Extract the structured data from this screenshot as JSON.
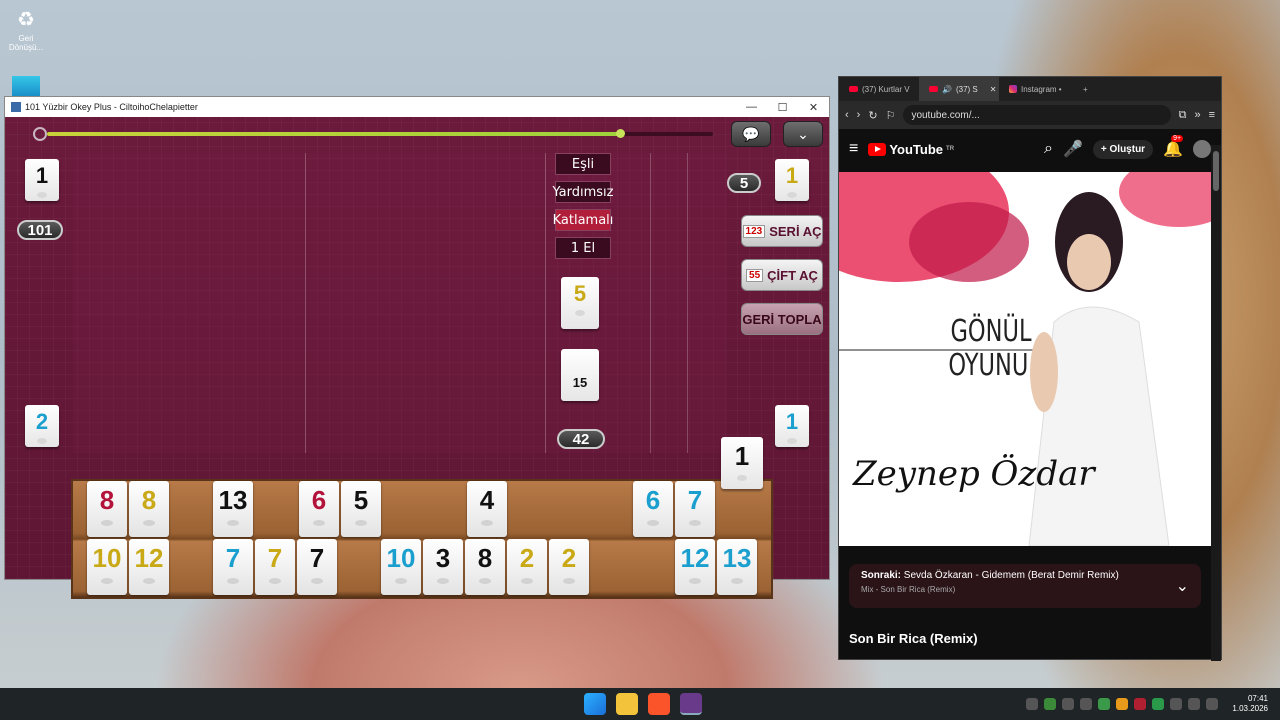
{
  "desktop": {
    "recycle_label_1": "Geri",
    "recycle_label_2": "Dönüşü..."
  },
  "game": {
    "window_title": "101 Yüzbir Okey Plus - CiltoihoChelapietter",
    "timer_progress": 0.86,
    "score_total": "101",
    "opponent_left_top": "1",
    "opponent_left_bottom": "2",
    "opponent_right_top": "1",
    "opponent_right_bottom": "1",
    "right_count": "5",
    "modes": [
      "Eşli",
      "Yardımsız",
      "Katlamalı",
      "1 El"
    ],
    "active_mode": "Katlamalı",
    "indicator_tile": "5",
    "deck_tile": "15",
    "remaining": "42",
    "drawn_tile": "1",
    "buttons": {
      "seri_ac": "SERİ AÇ",
      "cift_ac": "ÇİFT AÇ",
      "geri_topla": "GERİ TOPLA"
    },
    "rack_top": [
      {
        "v": "8",
        "c": "red"
      },
      {
        "v": "8",
        "c": "yellow"
      },
      {
        "v": "13",
        "c": "black"
      },
      {
        "v": "6",
        "c": "red"
      },
      {
        "v": "5",
        "c": "black"
      },
      {
        "v": "4",
        "c": "black"
      },
      {
        "v": "6",
        "c": "blue"
      },
      {
        "v": "7",
        "c": "blue"
      }
    ],
    "rack_bottom": [
      {
        "v": "10",
        "c": "yellow"
      },
      {
        "v": "12",
        "c": "yellow"
      },
      {
        "v": "7",
        "c": "blue"
      },
      {
        "v": "7",
        "c": "yellow"
      },
      {
        "v": "7",
        "c": "black"
      },
      {
        "v": "10",
        "c": "blue"
      },
      {
        "v": "3",
        "c": "black"
      },
      {
        "v": "8",
        "c": "black"
      },
      {
        "v": "2",
        "c": "yellow"
      },
      {
        "v": "2",
        "c": "yellow"
      },
      {
        "v": "12",
        "c": "blue"
      },
      {
        "v": "13",
        "c": "blue"
      }
    ]
  },
  "browser": {
    "tabs": [
      "(37) Kurtlar V",
      "(37) S",
      "Instagram •"
    ],
    "url": "youtube.com/...",
    "yt_brand": "YouTube",
    "yt_region": "TR",
    "create_label": "Oluştur",
    "notif_badge": "9+",
    "video_title_art_1": "GÖNÜL",
    "video_title_art_2": "OYUNU",
    "video_signature": "Zeynep Özdar",
    "upnext_label": "Sonraki:",
    "upnext_title": "Sevda Özkaran - Gidemem (Berat Demir Remix)",
    "upnext_sub": "Mix - Son Bir Rica (Remix)",
    "video_heading": "Son Bir Rica (Remix)"
  },
  "taskbar": {
    "time": "07:41",
    "date": "1.03.2026"
  },
  "colors": {
    "red_tile": "#b3123a",
    "yellow_tile": "#c9a916",
    "blue_tile": "#1a9fcf",
    "felt": "#5e1634"
  }
}
